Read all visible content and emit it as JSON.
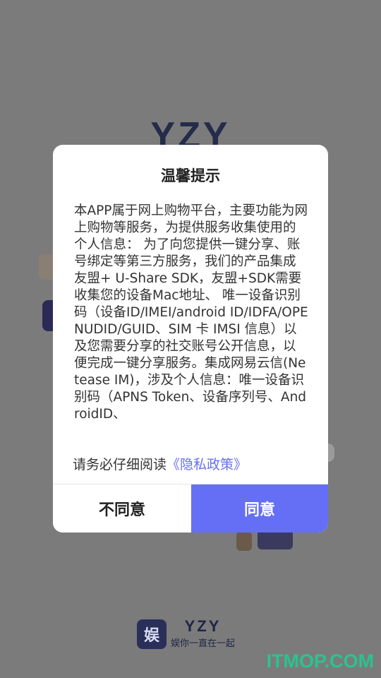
{
  "background": {
    "logo_text": "YZY",
    "brand_mark_char": "娱",
    "brand_name": "YZY",
    "brand_slogan": "娱你一直在一起",
    "watermark": "ITMOP.COM"
  },
  "dialog": {
    "title": "温馨提示",
    "body": "本APP属于网上购物平台，主要功能为网上购物等服务，为提供服务收集使用的个人信息： 为了向您提供一键分享、账号绑定等第三方服务，我们的产品集成友盟+ U-Share SDK，友盟+SDK需要收集您的设备Mac地址、 唯一设备识别码（设备ID/IMEI/android ID/IDFA/OPENUDID/GUID、SIM 卡 IMSI 信息）以及您需要分享的社交账号公开信息，以便完成一键分享服务。集成网易云信(Netease IM)，涉及个人信息：唯一设备识别码（APNS Token、设备序列号、AndroidID、",
    "policy_prefix": "请务必仔细阅读",
    "policy_link": "《隐私政策》",
    "disagree_label": "不同意",
    "agree_label": "同意"
  },
  "colors": {
    "overlay": "#7b7b7b",
    "accent": "#646ff6",
    "link": "#6670ee",
    "watermark": "#29c48f"
  }
}
